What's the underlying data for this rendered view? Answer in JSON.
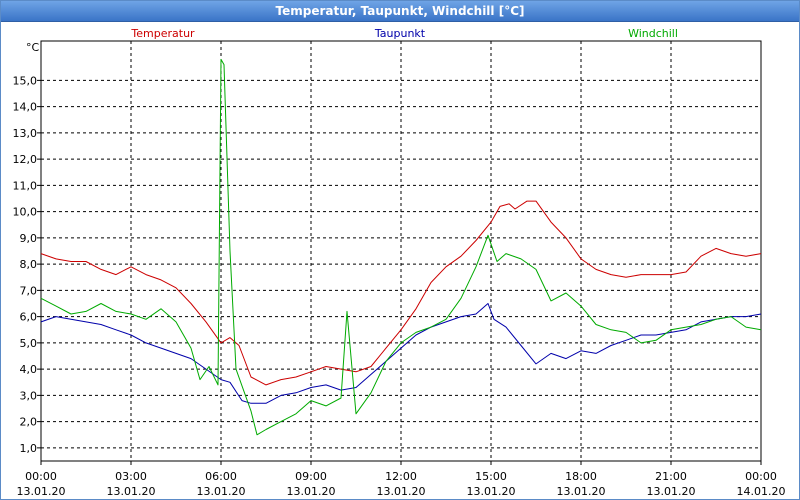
{
  "window": {
    "title": "Temperatur, Taupunkt, Windchill [°C]"
  },
  "chart_data": {
    "type": "line",
    "title": "Temperatur, Taupunkt, Windchill [°C]",
    "ylabel": "°C",
    "ylim": [
      0.5,
      16.5
    ],
    "xlim": [
      0,
      24
    ],
    "grid": true,
    "legend_placement": "top",
    "y_ticks": [
      "1,0",
      "2,0",
      "3,0",
      "4,0",
      "5,0",
      "6,0",
      "7,0",
      "8,0",
      "9,0",
      "10,0",
      "11,0",
      "12,0",
      "13,0",
      "14,0",
      "15,0"
    ],
    "x_ticks": [
      {
        "time": "00:00",
        "date": "13.01.20"
      },
      {
        "time": "03:00",
        "date": "13.01.20"
      },
      {
        "time": "06:00",
        "date": "13.01.20"
      },
      {
        "time": "09:00",
        "date": "13.01.20"
      },
      {
        "time": "12:00",
        "date": "13.01.20"
      },
      {
        "time": "15:00",
        "date": "13.01.20"
      },
      {
        "time": "18:00",
        "date": "13.01.20"
      },
      {
        "time": "21:00",
        "date": "13.01.20"
      },
      {
        "time": "00:00",
        "date": "14.01.20"
      }
    ],
    "series": [
      {
        "name": "Temperatur",
        "color": "#cc0000",
        "points": [
          [
            0,
            8.4
          ],
          [
            0.5,
            8.2
          ],
          [
            1,
            8.1
          ],
          [
            1.5,
            8.1
          ],
          [
            2,
            7.8
          ],
          [
            2.5,
            7.6
          ],
          [
            3,
            7.9
          ],
          [
            3.5,
            7.6
          ],
          [
            4,
            7.4
          ],
          [
            4.5,
            7.1
          ],
          [
            5,
            6.5
          ],
          [
            5.5,
            5.8
          ],
          [
            6,
            5.0
          ],
          [
            6.3,
            5.2
          ],
          [
            6.6,
            4.9
          ],
          [
            7,
            3.7
          ],
          [
            7.5,
            3.4
          ],
          [
            8,
            3.6
          ],
          [
            8.5,
            3.7
          ],
          [
            9,
            3.9
          ],
          [
            9.5,
            4.1
          ],
          [
            10,
            4.0
          ],
          [
            10.5,
            3.9
          ],
          [
            11,
            4.1
          ],
          [
            11.5,
            4.8
          ],
          [
            12,
            5.5
          ],
          [
            12.5,
            6.3
          ],
          [
            13,
            7.3
          ],
          [
            13.5,
            7.9
          ],
          [
            14,
            8.3
          ],
          [
            14.5,
            8.9
          ],
          [
            15,
            9.6
          ],
          [
            15.3,
            10.2
          ],
          [
            15.6,
            10.3
          ],
          [
            15.8,
            10.1
          ],
          [
            16.2,
            10.4
          ],
          [
            16.5,
            10.4
          ],
          [
            17,
            9.6
          ],
          [
            17.5,
            9.0
          ],
          [
            18,
            8.2
          ],
          [
            18.5,
            7.8
          ],
          [
            19,
            7.6
          ],
          [
            19.5,
            7.5
          ],
          [
            20,
            7.6
          ],
          [
            20.5,
            7.6
          ],
          [
            21,
            7.6
          ],
          [
            21.5,
            7.7
          ],
          [
            22,
            8.3
          ],
          [
            22.5,
            8.6
          ],
          [
            23,
            8.4
          ],
          [
            23.5,
            8.3
          ],
          [
            24,
            8.4
          ]
        ]
      },
      {
        "name": "Taupunkt",
        "color": "#0000aa",
        "points": [
          [
            0,
            5.8
          ],
          [
            0.5,
            6.0
          ],
          [
            1,
            5.9
          ],
          [
            1.5,
            5.8
          ],
          [
            2,
            5.7
          ],
          [
            2.5,
            5.5
          ],
          [
            3,
            5.3
          ],
          [
            3.5,
            5.0
          ],
          [
            4,
            4.8
          ],
          [
            4.5,
            4.6
          ],
          [
            5,
            4.4
          ],
          [
            5.5,
            4.0
          ],
          [
            6,
            3.6
          ],
          [
            6.3,
            3.5
          ],
          [
            6.7,
            2.8
          ],
          [
            7,
            2.7
          ],
          [
            7.5,
            2.7
          ],
          [
            8,
            3.0
          ],
          [
            8.5,
            3.1
          ],
          [
            9,
            3.3
          ],
          [
            9.5,
            3.4
          ],
          [
            10,
            3.2
          ],
          [
            10.5,
            3.3
          ],
          [
            11,
            3.8
          ],
          [
            11.5,
            4.3
          ],
          [
            12,
            4.8
          ],
          [
            12.5,
            5.3
          ],
          [
            13,
            5.6
          ],
          [
            13.5,
            5.8
          ],
          [
            14,
            6.0
          ],
          [
            14.5,
            6.1
          ],
          [
            14.9,
            6.5
          ],
          [
            15.1,
            5.9
          ],
          [
            15.5,
            5.6
          ],
          [
            16,
            4.9
          ],
          [
            16.5,
            4.2
          ],
          [
            17,
            4.6
          ],
          [
            17.5,
            4.4
          ],
          [
            18,
            4.7
          ],
          [
            18.5,
            4.6
          ],
          [
            19,
            4.9
          ],
          [
            19.5,
            5.1
          ],
          [
            20,
            5.3
          ],
          [
            20.5,
            5.3
          ],
          [
            21,
            5.4
          ],
          [
            21.5,
            5.5
          ],
          [
            22,
            5.8
          ],
          [
            22.5,
            5.9
          ],
          [
            23,
            6.0
          ],
          [
            23.5,
            6.0
          ],
          [
            24,
            6.1
          ]
        ]
      },
      {
        "name": "Windchill",
        "color": "#00aa00",
        "points": [
          [
            0,
            6.7
          ],
          [
            0.5,
            6.4
          ],
          [
            1,
            6.1
          ],
          [
            1.5,
            6.2
          ],
          [
            2,
            6.5
          ],
          [
            2.5,
            6.2
          ],
          [
            3,
            6.1
          ],
          [
            3.5,
            5.9
          ],
          [
            4,
            6.3
          ],
          [
            4.5,
            5.8
          ],
          [
            5,
            4.8
          ],
          [
            5.3,
            3.6
          ],
          [
            5.6,
            4.1
          ],
          [
            5.9,
            3.4
          ],
          [
            6.0,
            15.8
          ],
          [
            6.1,
            15.6
          ],
          [
            6.3,
            8.5
          ],
          [
            6.5,
            4.0
          ],
          [
            7,
            2.4
          ],
          [
            7.2,
            1.5
          ],
          [
            7.5,
            1.7
          ],
          [
            8,
            2.0
          ],
          [
            8.5,
            2.3
          ],
          [
            9,
            2.8
          ],
          [
            9.5,
            2.6
          ],
          [
            10,
            2.9
          ],
          [
            10.2,
            6.2
          ],
          [
            10.5,
            2.3
          ],
          [
            11,
            3.1
          ],
          [
            11.5,
            4.3
          ],
          [
            12,
            5.0
          ],
          [
            12.5,
            5.4
          ],
          [
            13,
            5.6
          ],
          [
            13.5,
            5.9
          ],
          [
            14,
            6.7
          ],
          [
            14.5,
            7.9
          ],
          [
            14.9,
            9.1
          ],
          [
            15.2,
            8.1
          ],
          [
            15.5,
            8.4
          ],
          [
            16,
            8.2
          ],
          [
            16.5,
            7.8
          ],
          [
            17,
            6.6
          ],
          [
            17.5,
            6.9
          ],
          [
            18,
            6.4
          ],
          [
            18.5,
            5.7
          ],
          [
            19,
            5.5
          ],
          [
            19.5,
            5.4
          ],
          [
            20,
            5.0
          ],
          [
            20.5,
            5.1
          ],
          [
            21,
            5.5
          ],
          [
            21.5,
            5.6
          ],
          [
            22,
            5.7
          ],
          [
            22.5,
            5.9
          ],
          [
            23,
            6.0
          ],
          [
            23.5,
            5.6
          ],
          [
            24,
            5.5
          ]
        ]
      }
    ]
  }
}
